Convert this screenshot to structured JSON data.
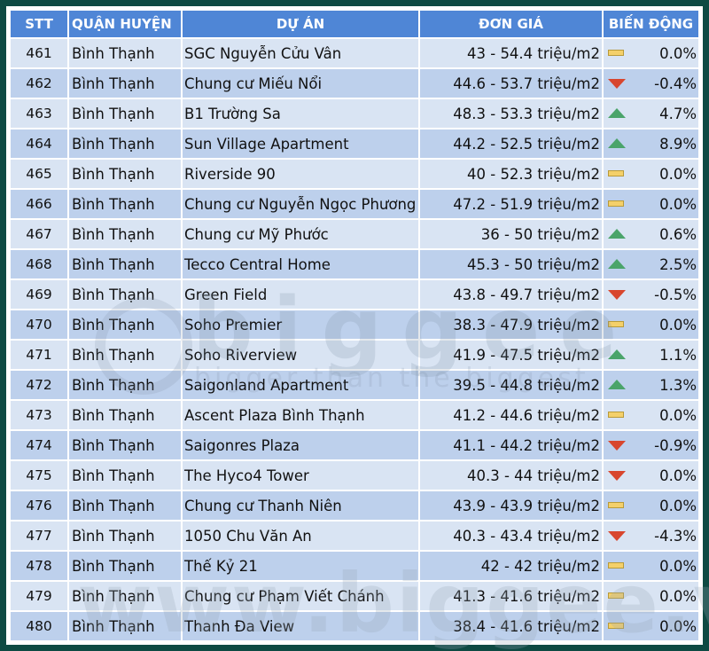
{
  "headers": {
    "stt": "STT",
    "quan": "QUẬN HUYỆN",
    "duan": "DỰ ÁN",
    "gia": "ĐƠN GIÁ",
    "bd": "BIẾN ĐỘNG"
  },
  "rows": [
    {
      "stt": "461",
      "quan": "Bình Thạnh",
      "duan": "SGC Nguyễn Cửu Vân",
      "gia": "43 - 54.4 triệu/m2",
      "trend": "flat",
      "bd": "0.0%"
    },
    {
      "stt": "462",
      "quan": "Bình Thạnh",
      "duan": "Chung cư Miếu Nổi",
      "gia": "44.6 - 53.7 triệu/m2",
      "trend": "down",
      "bd": "-0.4%"
    },
    {
      "stt": "463",
      "quan": "Bình Thạnh",
      "duan": "B1 Trường Sa",
      "gia": "48.3 - 53.3 triệu/m2",
      "trend": "up",
      "bd": "4.7%"
    },
    {
      "stt": "464",
      "quan": "Bình Thạnh",
      "duan": "Sun Village Apartment",
      "gia": "44.2 - 52.5 triệu/m2",
      "trend": "up",
      "bd": "8.9%"
    },
    {
      "stt": "465",
      "quan": "Bình Thạnh",
      "duan": "Riverside 90",
      "gia": "40 - 52.3 triệu/m2",
      "trend": "flat",
      "bd": "0.0%"
    },
    {
      "stt": "466",
      "quan": "Bình Thạnh",
      "duan": "Chung cư Nguyễn Ngọc Phương",
      "gia": "47.2 - 51.9 triệu/m2",
      "trend": "flat",
      "bd": "0.0%"
    },
    {
      "stt": "467",
      "quan": "Bình Thạnh",
      "duan": "Chung cư Mỹ Phước",
      "gia": "36 - 50 triệu/m2",
      "trend": "up",
      "bd": "0.6%"
    },
    {
      "stt": "468",
      "quan": "Bình Thạnh",
      "duan": "Tecco Central Home",
      "gia": "45.3 - 50 triệu/m2",
      "trend": "up",
      "bd": "2.5%"
    },
    {
      "stt": "469",
      "quan": "Bình Thạnh",
      "duan": "Green Field",
      "gia": "43.8 - 49.7 triệu/m2",
      "trend": "down",
      "bd": "-0.5%"
    },
    {
      "stt": "470",
      "quan": "Bình Thạnh",
      "duan": "Soho Premier",
      "gia": "38.3 - 47.9 triệu/m2",
      "trend": "flat",
      "bd": "0.0%"
    },
    {
      "stt": "471",
      "quan": "Bình Thạnh",
      "duan": "Soho Riverview",
      "gia": "41.9 - 47.5 triệu/m2",
      "trend": "up",
      "bd": "1.1%"
    },
    {
      "stt": "472",
      "quan": "Bình Thạnh",
      "duan": "Saigonland Apartment",
      "gia": "39.5 - 44.8 triệu/m2",
      "trend": "up",
      "bd": "1.3%"
    },
    {
      "stt": "473",
      "quan": "Bình Thạnh",
      "duan": "Ascent Plaza Bình Thạnh",
      "gia": "41.2 - 44.6 triệu/m2",
      "trend": "flat",
      "bd": "0.0%"
    },
    {
      "stt": "474",
      "quan": "Bình Thạnh",
      "duan": "Saigonres Plaza",
      "gia": "41.1 - 44.2 triệu/m2",
      "trend": "down",
      "bd": "-0.9%"
    },
    {
      "stt": "475",
      "quan": "Bình Thạnh",
      "duan": "The Hyco4 Tower",
      "gia": "40.3 - 44 triệu/m2",
      "trend": "down",
      "bd": "0.0%"
    },
    {
      "stt": "476",
      "quan": "Bình Thạnh",
      "duan": "Chung cư Thanh Niên",
      "gia": "43.9 - 43.9 triệu/m2",
      "trend": "flat",
      "bd": "0.0%"
    },
    {
      "stt": "477",
      "quan": "Bình Thạnh",
      "duan": "1050 Chu Văn An",
      "gia": "40.3 - 43.4 triệu/m2",
      "trend": "down",
      "bd": "-4.3%"
    },
    {
      "stt": "478",
      "quan": "Bình Thạnh",
      "duan": "Thế Kỷ 21",
      "gia": "42 - 42 triệu/m2",
      "trend": "flat",
      "bd": "0.0%"
    },
    {
      "stt": "479",
      "quan": "Bình Thạnh",
      "duan": "Chung cư Phạm Viết Chánh",
      "gia": "41.3 - 41.6 triệu/m2",
      "trend": "flat",
      "bd": "0.0%"
    },
    {
      "stt": "480",
      "quan": "Bình Thạnh",
      "duan": "Thanh Đa View",
      "gia": "38.4 - 41.6 triệu/m2",
      "trend": "flat",
      "bd": "0.0%"
    }
  ],
  "watermark": {
    "brand": "biggee",
    "tagline": "bigger than the biggest",
    "site": "www.biggee.vn"
  },
  "trend_icons": {
    "flat": "flat-bar-icon",
    "up": "up-triangle-icon",
    "down": "down-triangle-icon"
  },
  "colors": {
    "header_bg": "#4f86d6",
    "row_light": "#d9e4f3",
    "row_dark": "#bdd0ec",
    "frame": "#0e4a43",
    "up": "#4aa46a",
    "down": "#d8462e",
    "flat": "#f4d06a"
  }
}
